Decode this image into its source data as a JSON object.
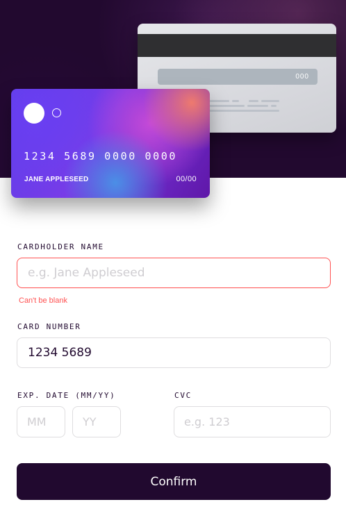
{
  "card_back": {
    "cvc": "000"
  },
  "card_front": {
    "number": "1234 5689 0000 0000",
    "holder_name": "JANE APPLESEED",
    "expiry": "00/00"
  },
  "form": {
    "cardholder": {
      "label": "CARDHOLDER NAME",
      "placeholder": "e.g. Jane Appleseed",
      "value": "",
      "error": "Can't be blank"
    },
    "card_number": {
      "label": "CARD NUMBER",
      "placeholder": "",
      "value": "1234 5689"
    },
    "expiry": {
      "label": "EXP. DATE (MM/YY)",
      "month_placeholder": "MM",
      "year_placeholder": "YY"
    },
    "cvc": {
      "label": "CVC",
      "placeholder": "e.g. 123"
    },
    "confirm_label": "Confirm"
  },
  "colors": {
    "dark_violet": "#21092f",
    "error_red": "#ff5050",
    "border_gray": "#dedddf"
  },
  "icons": {
    "card_logo": [
      "circle-filled-icon",
      "circle-outline-icon"
    ]
  }
}
